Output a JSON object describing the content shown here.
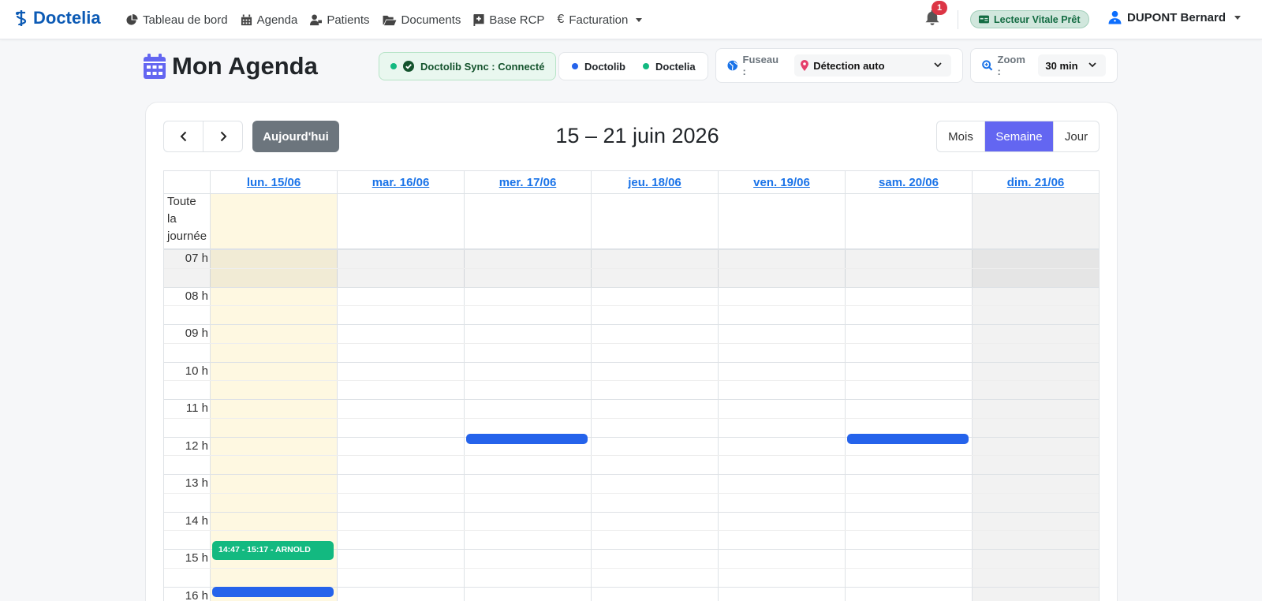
{
  "brand": {
    "name": "Doctelia"
  },
  "nav": {
    "items": [
      {
        "label": "Tableau de bord",
        "icon": "chart-pie-icon"
      },
      {
        "label": "Agenda",
        "icon": "calendar-icon"
      },
      {
        "label": "Patients",
        "icon": "user-injured-icon"
      },
      {
        "label": "Documents",
        "icon": "folder-open-icon"
      },
      {
        "label": "Base RCP",
        "icon": "book-medical-icon"
      },
      {
        "label": "Facturation",
        "icon": "euro-icon"
      }
    ],
    "notifications_count": "1",
    "vitale_status": "Lecteur Vitale Prêt",
    "user_name": "DUPONT Bernard"
  },
  "toolbar": {
    "title": "Mon Agenda",
    "sync_status": "Doctolib Sync : Connecté",
    "legend": [
      {
        "label": "Doctolib",
        "color": "#2563eb"
      },
      {
        "label": "Doctelia",
        "color": "#13b980"
      }
    ],
    "timezone_label": "Fuseau :",
    "timezone_value": "Détection auto",
    "zoom_label": "Zoom :",
    "zoom_value": "30 min"
  },
  "calendar": {
    "today_label": "Aujourd'hui",
    "period_title": "15 – 21 juin 2026",
    "views": [
      {
        "label": "Mois",
        "active": false
      },
      {
        "label": "Semaine",
        "active": true
      },
      {
        "label": "Jour",
        "active": false
      }
    ],
    "allday_label": "Toute la journée",
    "days": [
      "lun. 15/06",
      "mar. 16/06",
      "mer. 17/06",
      "jeu. 18/06",
      "ven. 19/06",
      "sam. 20/06",
      "dim. 21/06"
    ],
    "hours": [
      "07 h",
      "08 h",
      "09 h",
      "10 h",
      "11 h",
      "12 h",
      "13 h",
      "14 h",
      "15 h",
      "16 h"
    ],
    "events": [
      {
        "day": 0,
        "start": "14:47",
        "end": "15:17",
        "label": "14:47 - 15:17 - ARNOLD",
        "source": "Doctelia"
      },
      {
        "day": 2,
        "start": "11:55",
        "end": "12:15",
        "label": "",
        "source": "Doctolib"
      },
      {
        "day": 5,
        "start": "11:55",
        "end": "12:15",
        "label": "",
        "source": "Doctolib"
      },
      {
        "day": 0,
        "start": "16:00",
        "end": "16:15",
        "label": "",
        "source": "Doctolib"
      }
    ]
  }
}
